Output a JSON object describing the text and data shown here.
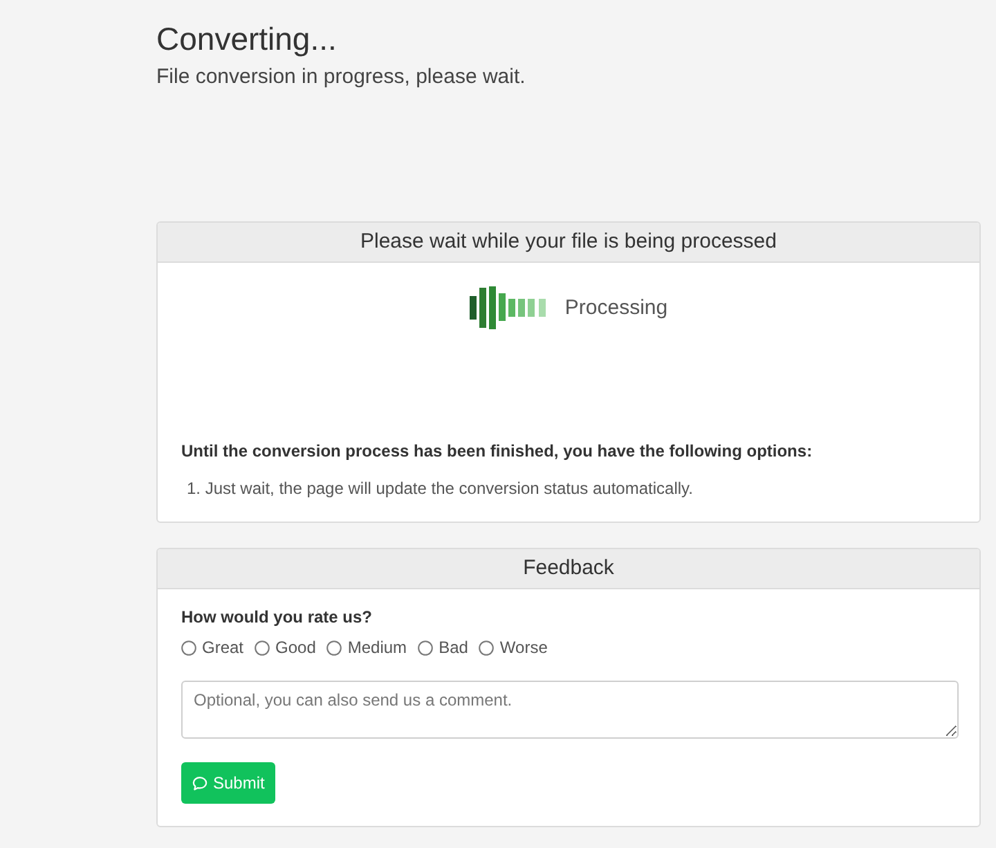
{
  "page": {
    "title": "Converting...",
    "subtitle": "File conversion in progress, please wait."
  },
  "status_card": {
    "heading": "Please wait while your file is being processed",
    "status": "Processing",
    "options_intro": "Until the conversion process has been finished, you have the following options:",
    "options": [
      "1. Just wait, the page will update the conversion status automatically."
    ]
  },
  "feedback_card": {
    "heading": "Feedback",
    "question": "How would you rate us?",
    "ratings": [
      {
        "label": "Great",
        "selected": false
      },
      {
        "label": "Good",
        "selected": false
      },
      {
        "label": "Medium",
        "selected": false
      },
      {
        "label": "Bad",
        "selected": false
      },
      {
        "label": "Worse",
        "selected": false
      }
    ],
    "comment": {
      "placeholder": "Optional, you can also send us a comment."
    },
    "submit_button": "Submit"
  }
}
